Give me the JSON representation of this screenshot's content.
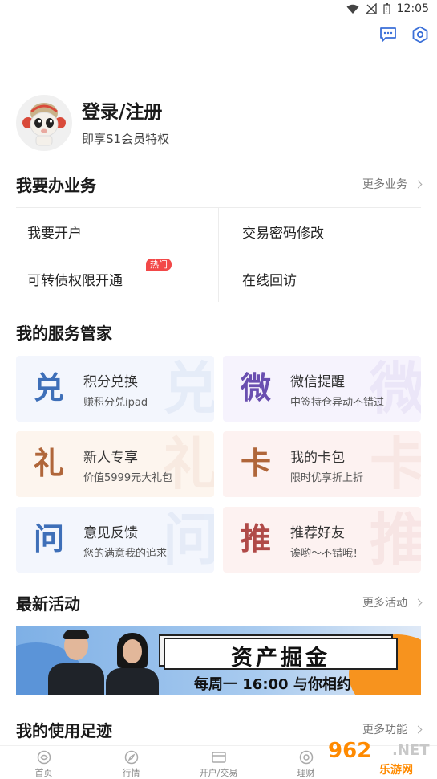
{
  "status_bar": {
    "time": "12:05"
  },
  "profile": {
    "title": "登录/注册",
    "subtitle": "即享S1会员特权"
  },
  "business": {
    "title": "我要办业务",
    "more": "更多业务",
    "items": [
      {
        "label": "我要开户"
      },
      {
        "label": "交易密码修改"
      },
      {
        "label": "可转债权限开通",
        "badge": "热门"
      },
      {
        "label": "在线回访"
      }
    ]
  },
  "services": {
    "title": "我的服务管家",
    "cards": [
      {
        "glyph": "兑",
        "title": "积分兑换",
        "subtitle": "赚积分兑ipad",
        "color": "#3e6fb8"
      },
      {
        "glyph": "微",
        "title": "微信提醒",
        "subtitle": "中签持仓异动不错过",
        "color": "#6a4fb0"
      },
      {
        "glyph": "礼",
        "title": "新人专享",
        "subtitle": "价值5999元大礼包",
        "color": "#b0663a"
      },
      {
        "glyph": "卡",
        "title": "我的卡包",
        "subtitle": "限时优享折上折",
        "color": "#b0663a"
      },
      {
        "glyph": "问",
        "title": "意见反馈",
        "subtitle": "您的满意我的追求",
        "color": "#3e6fb8"
      },
      {
        "glyph": "推",
        "title": "推荐好友",
        "subtitle": "诶哟～不错哦！",
        "color": "#b04a48"
      }
    ]
  },
  "activities": {
    "title": "最新活动",
    "more": "更多活动",
    "banner": {
      "headline": "资产掘金",
      "slogan": "每周一  16:00 与你相约"
    }
  },
  "footprint": {
    "title": "我的使用足迹",
    "more": "更多功能"
  },
  "bottom_nav": [
    {
      "label": "首页",
      "icon": "home-icon"
    },
    {
      "label": "行情",
      "icon": "compass-icon"
    },
    {
      "label": "开户/交易",
      "icon": "card-icon"
    },
    {
      "label": "理财",
      "icon": "wealth-icon"
    },
    {
      "label": ""
    }
  ],
  "watermark": {
    "top": "962",
    "net": ".NET",
    "bottom": "乐游网"
  }
}
